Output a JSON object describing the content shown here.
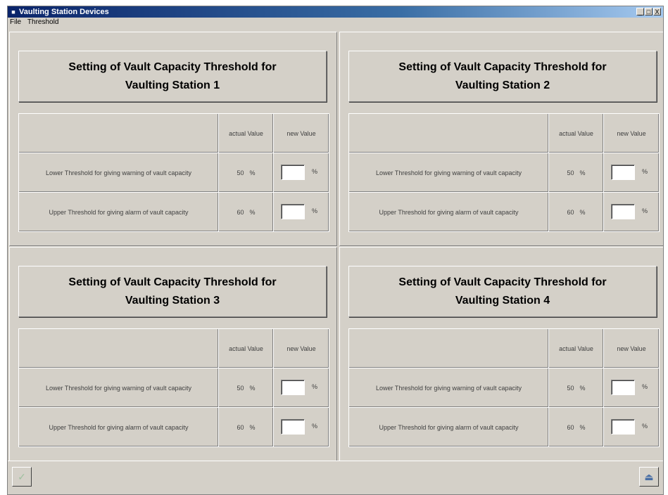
{
  "window": {
    "title": "Vaulting Station Devices",
    "controls": [
      "_",
      "□",
      "X"
    ]
  },
  "menu": [
    "File",
    "Threshold"
  ],
  "table_headers": {
    "actual": "actual Value",
    "new": "new Value"
  },
  "stations": [
    {
      "title": "Setting of Vault Capacity Threshold for Vaulting Station 1",
      "rows": [
        {
          "label": "Lower Threshold for giving warning of vault capacity",
          "actual": "50",
          "unit": "%",
          "new_value": ""
        },
        {
          "label": "Upper Threshold for giving alarm of vault capacity",
          "actual": "60",
          "unit": "%",
          "new_value": ""
        }
      ]
    },
    {
      "title": "Setting of Vault Capacity Threshold for Vaulting Station 2",
      "rows": [
        {
          "label": "Lower Threshold for giving warning of vault capacity",
          "actual": "50",
          "unit": "%",
          "new_value": ""
        },
        {
          "label": "Upper Threshold for giving alarm of vault capacity",
          "actual": "60",
          "unit": "%",
          "new_value": ""
        }
      ]
    },
    {
      "title": "Setting of Vault Capacity Threshold for Vaulting Station 3",
      "rows": [
        {
          "label": "Lower Threshold for giving warning of vault capacity",
          "actual": "50",
          "unit": "%",
          "new_value": ""
        },
        {
          "label": "Upper Threshold for giving alarm of vault capacity",
          "actual": "60",
          "unit": "%",
          "new_value": ""
        }
      ]
    },
    {
      "title": "Setting of Vault Capacity Threshold for Vaulting Station 4",
      "rows": [
        {
          "label": "Lower Threshold for giving warning of vault capacity",
          "actual": "50",
          "unit": "%",
          "new_value": ""
        },
        {
          "label": "Upper Threshold for giving alarm of vault capacity",
          "actual": "60",
          "unit": "%",
          "new_value": ""
        }
      ]
    }
  ],
  "footer": {
    "left_icon": "confirm-icon",
    "right_icon": "exit-door-icon"
  },
  "colors": {
    "titlebar_start": "#0a246a",
    "titlebar_end": "#a6caf0",
    "face": "#d4d0c8"
  }
}
